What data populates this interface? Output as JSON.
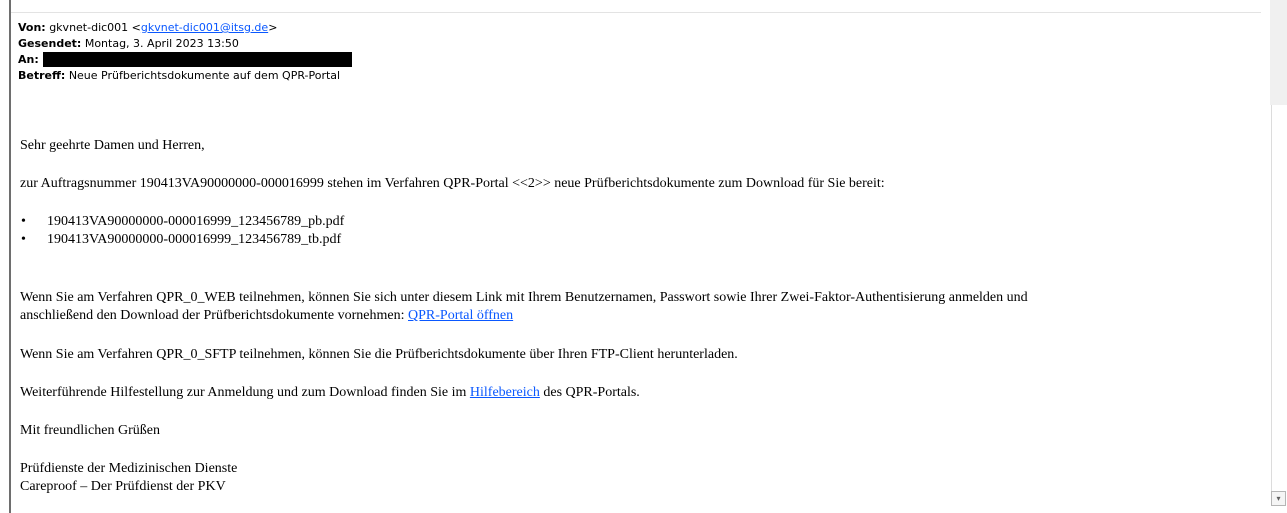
{
  "header": {
    "from_label": "Von:",
    "from_name": "gkvnet-dic001 <",
    "from_email": "gkvnet-dic001@itsg.de",
    "from_close": ">",
    "sent_label": "Gesendet:",
    "sent_value": "Montag, 3. April 2023 13:50",
    "to_label": "An:",
    "subject_label": "Betreff:",
    "subject_value": "Neue Prüfberichtsdokumente auf dem QPR-Portal"
  },
  "body": {
    "greeting": "Sehr geehrte Damen und Herren,",
    "intro": "zur Auftragsnummer 190413VA90000000-000016999 stehen im Verfahren QPR-Portal <<2>> neue Prüfberichtsdokumente zum Download für Sie bereit:",
    "files": [
      "190413VA90000000-000016999_123456789_pb.pdf",
      "190413VA90000000-000016999_123456789_tb.pdf"
    ],
    "bullet_char": "•",
    "web_line1": "Wenn Sie am Verfahren QPR_0_WEB teilnehmen, können Sie sich unter diesem Link mit Ihrem Benutzernamen, Passwort sowie Ihrer Zwei-Faktor-Authentisierung anmelden und",
    "web_line2": "anschließend den Download der Prüfberichtsdokumente vornehmen: ",
    "portal_link": "QPR-Portal öffnen",
    "sftp": "Wenn Sie am Verfahren QPR_0_SFTP teilnehmen, können Sie die Prüfberichtsdokumente über Ihren FTP-Client herunterladen.",
    "help_before": "Weiterführende Hilfestellung zur Anmeldung und zum Download finden Sie im ",
    "help_link": "Hilfebereich",
    "help_after": " des QPR-Portals.",
    "closing": "Mit freundlichen Grüßen",
    "sig1": "Prüfdienste der Medizinischen Dienste",
    "sig2": "Careproof – Der Prüfdienst der PKV"
  },
  "scrollbar": {
    "down_arrow": "▾"
  },
  "colors": {
    "link": "#0a58ff",
    "rule": "#6e6e6e"
  }
}
